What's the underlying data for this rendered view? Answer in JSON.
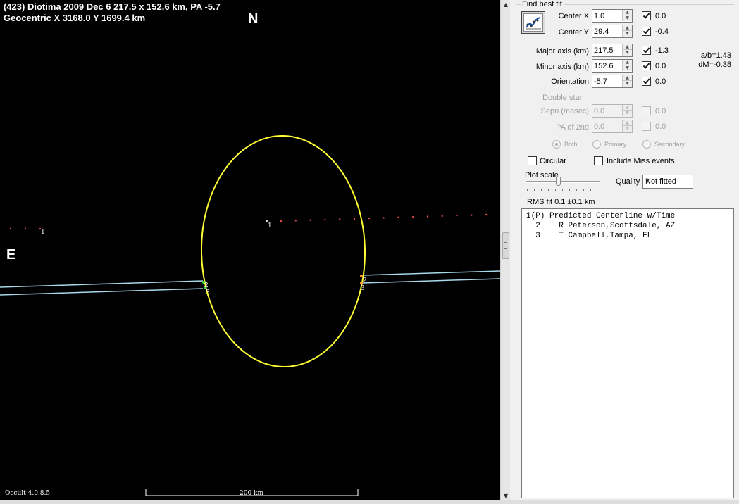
{
  "plot": {
    "header_line1": "(423) Diotima  2009 Dec 6   217.5 x 152.6 km, PA -5.7",
    "header_line2": "Geocentric  X  3168.0  Y  1699.4 km",
    "north_label": "N",
    "east_label": "E",
    "version": "Occult 4.0.8.5",
    "scale_label": "200 km",
    "chord_marks": {
      "left_predicted": "1",
      "center_predicted": "1",
      "left_2": "2",
      "left_3": "3",
      "right_2": "2",
      "right_3": "3"
    },
    "colors": {
      "background": "#000000",
      "ellipse": "#ffff33",
      "chords": "#a8d8ea",
      "predicted_dots": "#e84b4b"
    }
  },
  "panel": {
    "find_best_fit": "Find best fit",
    "fit_button_icon": "chart-fit-icon",
    "fields": [
      {
        "label": "Center X",
        "value": "1.0",
        "checked": true,
        "check_value": "0.0"
      },
      {
        "label": "Center Y",
        "value": "29.4",
        "checked": true,
        "check_value": "-0.4"
      },
      {
        "label": "Major axis (km)",
        "value": "217.5",
        "checked": true,
        "check_value": "-1.3"
      },
      {
        "label": "Minor axis (km)",
        "value": "152.6",
        "checked": true,
        "check_value": "0.0"
      },
      {
        "label": "Orientation",
        "value": "-5.7",
        "checked": true,
        "check_value": "0.0"
      }
    ],
    "ratio": "a/b=1.43",
    "dm": "dM=-0.38",
    "double_star": {
      "title": "Double star",
      "fields": [
        {
          "label": "Sepn (masec)",
          "value": "0.0",
          "check_value": "0.0"
        },
        {
          "label": "PA of 2nd",
          "value": "0.0",
          "check_value": "0.0"
        }
      ],
      "radios": [
        "Both",
        "Primary",
        "Secondary"
      ],
      "selected": "Both"
    },
    "circular_label": "Circular",
    "include_miss_label": "Include Miss events",
    "plot_scale_label": "Plot scale",
    "quality_label": "Quality",
    "quality_value": "Not fitted",
    "rms_fit": "RMS fit  0.1 ±0.1 km",
    "observers": [
      {
        "id": "1(P)",
        "name": "Predicted Centerline w/Time"
      },
      {
        "id": "2",
        "name": "R Peterson,Scottsdale, AZ"
      },
      {
        "id": "3",
        "name": "T Campbell,Tampa, FL"
      }
    ]
  }
}
